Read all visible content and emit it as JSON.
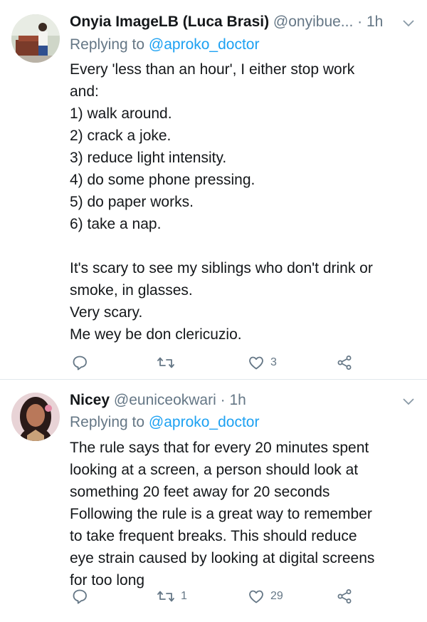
{
  "tweets": [
    {
      "display_name": "Onyia ImageLB (Luca Brasi)",
      "handle": "@onyibue...",
      "separator": "·",
      "time": "1h",
      "replying_prefix": "Replying to",
      "replying_to": "@aproko_doctor",
      "lines": [
        "Every 'less than an hour', I either stop work",
        "and:",
        "1) walk around.",
        "2) crack a joke.",
        "3) reduce light intensity.",
        "4) do some phone pressing.",
        "5) do paper works.",
        "6) take a nap.",
        "",
        "It's scary to see my siblings who don't drink or",
        "smoke, in glasses.",
        "Very scary.",
        "Me wey be don clericuzio."
      ],
      "reply_count": "",
      "retweet_count": "",
      "like_count": "3"
    },
    {
      "display_name": "Nicey",
      "handle": "@euniceokwari",
      "separator": "·",
      "time": "1h",
      "replying_prefix": "Replying to",
      "replying_to": "@aproko_doctor",
      "lines": [
        "The rule says that for every 20 minutes spent",
        "looking at a screen, a person should look at",
        "something 20 feet away for 20 seconds",
        "Following the rule is a great way to remember",
        "to take frequent breaks. This should reduce",
        "eye strain caused by looking at digital screens",
        "for too long"
      ],
      "reply_count": "",
      "retweet_count": "1",
      "like_count": "29"
    }
  ],
  "icons": {
    "reply": "reply-icon",
    "retweet": "retweet-icon",
    "like": "heart-icon",
    "share": "share-icon",
    "caret": "chevron-down-icon"
  },
  "colors": {
    "text": "#14171a",
    "secondary": "#657786",
    "link": "#1da1f2",
    "divider": "#e1e8ed"
  }
}
